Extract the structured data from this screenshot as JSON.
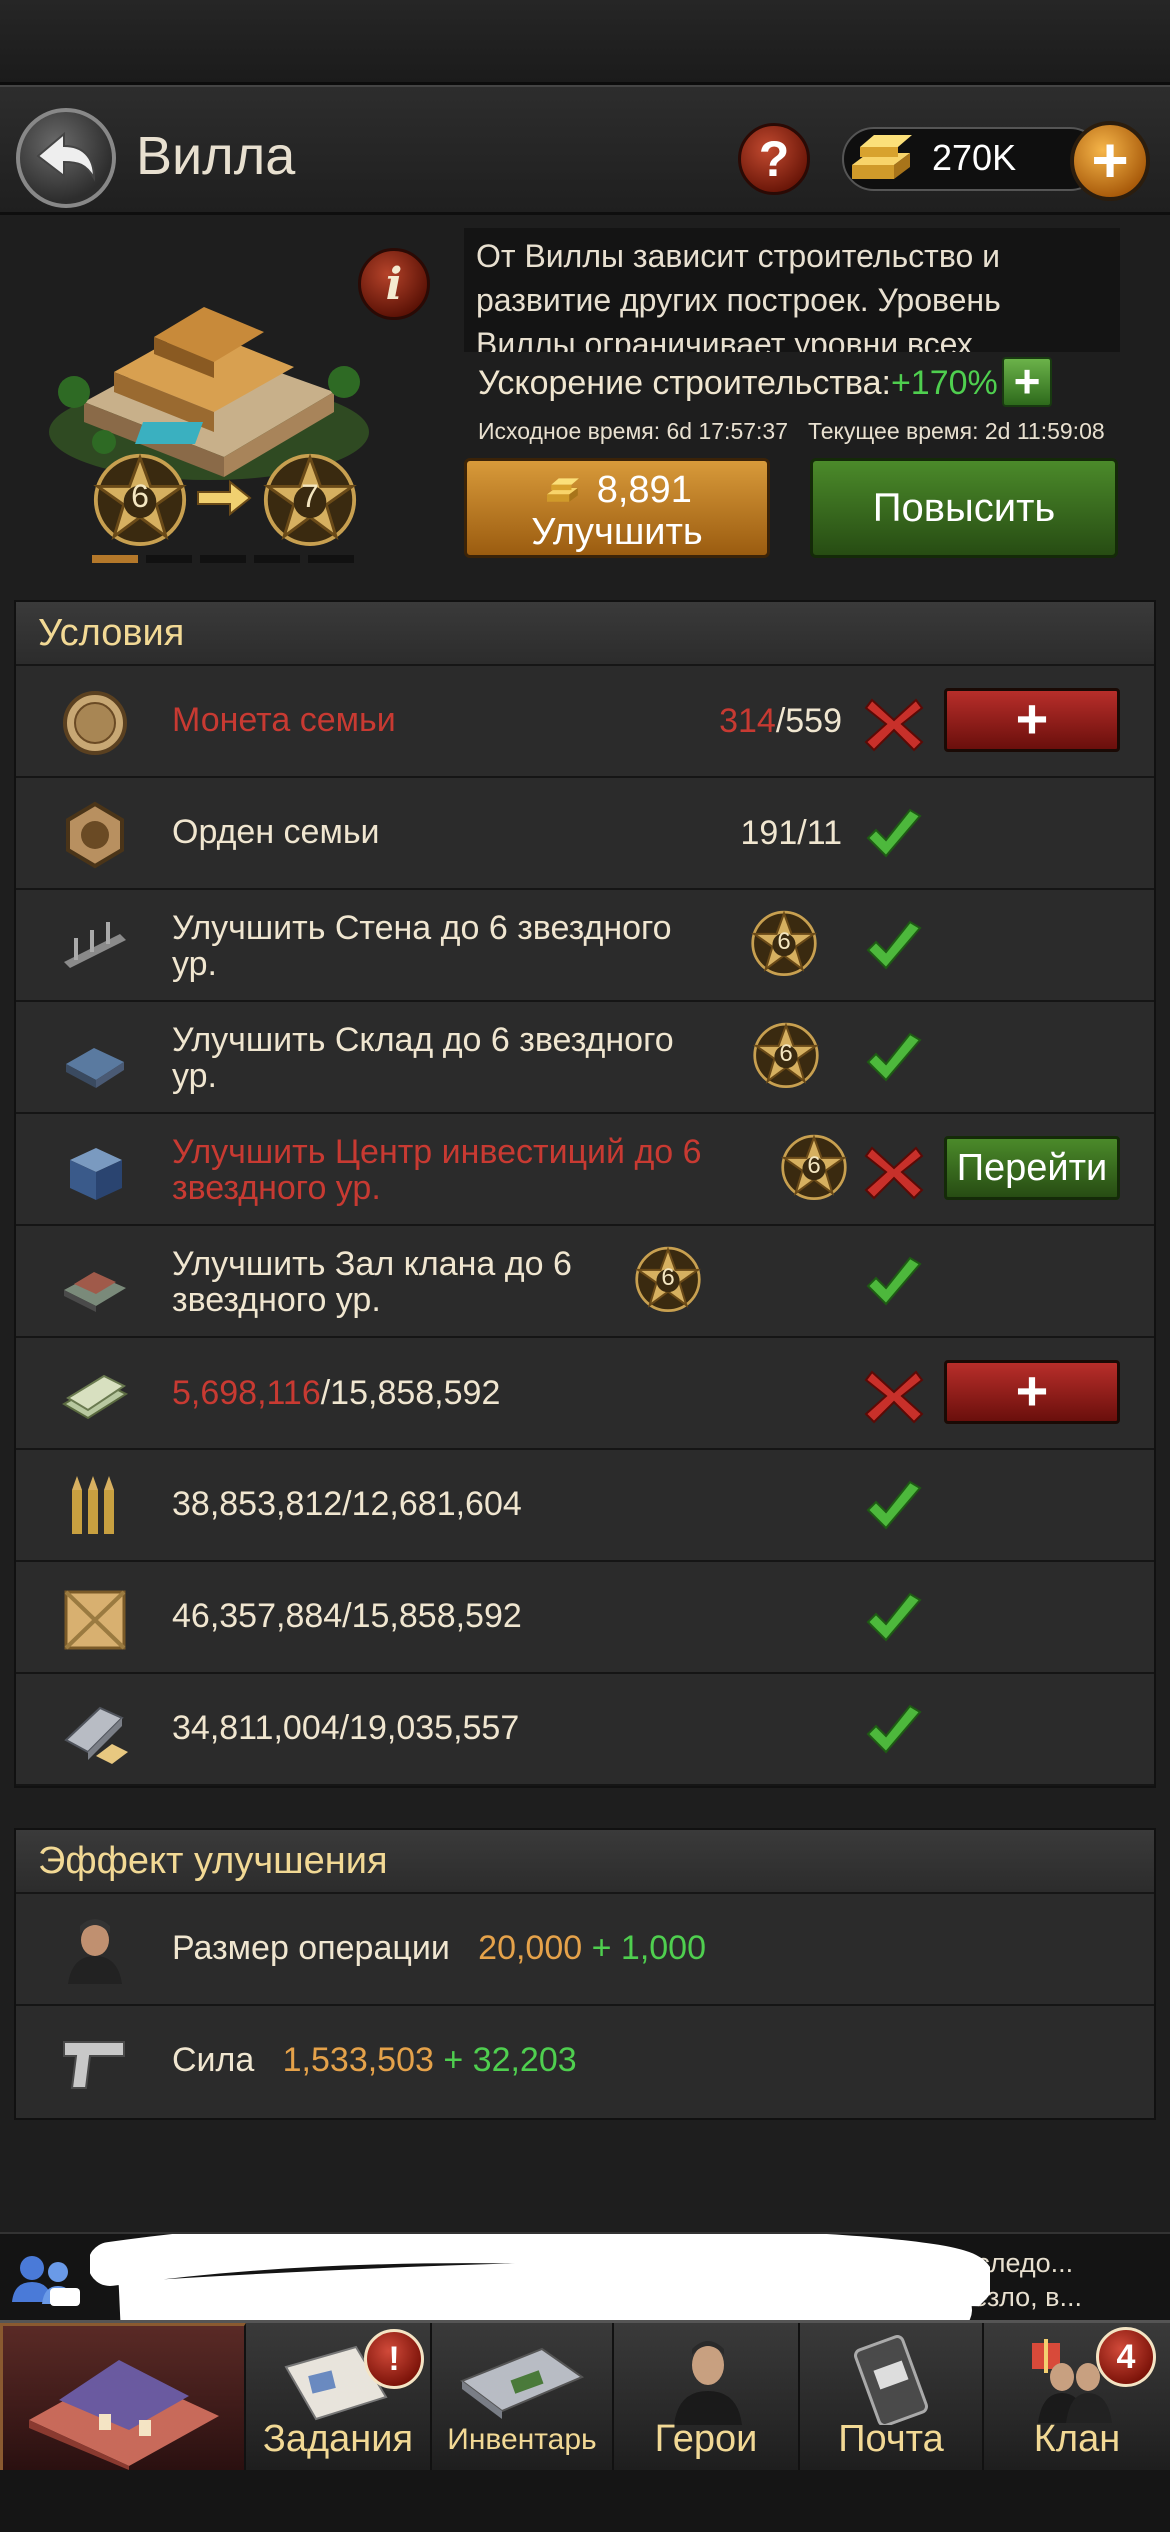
{
  "header": {
    "title": "Вилла",
    "help_icon": "?",
    "gold_amount": "270K",
    "gold_plus": "+"
  },
  "building": {
    "info_icon": "i",
    "description": "От Виллы зависит строительство и развитие других построек. Уровень Виллы ограничивает уровни всех",
    "accel_label": "Ускорение строительства:",
    "accel_value": "+170%",
    "accel_plus": "+",
    "original_time": "Исходное время: 6d 17:57:37",
    "current_time": "Текущее время: 2d 11:59:08",
    "level_from": "6",
    "level_to": "7",
    "upgrade_cost": "8,891",
    "upgrade_label": "Улучшить",
    "promote_label": "Повысить"
  },
  "conditions": {
    "title": "Условия",
    "rows": [
      {
        "icon": "family-coin-icon",
        "label": "Монета семьи",
        "have": "314",
        "need": "/559",
        "met": false,
        "action": "+"
      },
      {
        "icon": "family-order-icon",
        "label": "Орден семьи",
        "have": "191",
        "need": "/11",
        "met": true
      },
      {
        "icon": "wall-icon",
        "line1": "Улучшить Стена до 6 звездного",
        "line2": "ур.",
        "level": "6",
        "met": true
      },
      {
        "icon": "warehouse-icon",
        "line1": "Улучшить Склад до 6 звездного",
        "line2": "ур.",
        "level": "6",
        "met": true
      },
      {
        "icon": "investment-center-icon",
        "line1": "Улучшить Центр инвестиций до 6",
        "line2": "звездного ур.",
        "level": "6",
        "met": false,
        "action": "Перейти"
      },
      {
        "icon": "clan-hall-icon",
        "line1": "Улучшить Зал клана до 6",
        "line2": "звездного ур.",
        "level": "6",
        "met": true
      },
      {
        "icon": "cash-icon",
        "have": "5,698,116",
        "need": "/15,858,592",
        "met": false,
        "action": "+"
      },
      {
        "icon": "ammo-icon",
        "value": "38,853,812/12,681,604",
        "met": true
      },
      {
        "icon": "crate-icon",
        "value": "46,357,884/15,858,592",
        "met": true
      },
      {
        "icon": "metal-icon",
        "value": "34,811,004/19,035,557",
        "met": true
      }
    ]
  },
  "effect": {
    "title": "Эффект улучшения",
    "rows": [
      {
        "icon": "gangster-icon",
        "label": "Размер операции",
        "value": "20,000",
        "increase": "+ 1,000"
      },
      {
        "icon": "pistol-icon",
        "label": "Сила",
        "value": "1,533,503",
        "increase": "+ 32,203"
      }
    ]
  },
  "chat": {
    "line1": "ностью исследо...",
    "line2": "ретно повезло, в..."
  },
  "nav": {
    "tasks": "Задания",
    "tasks_badge": "!",
    "inventory": "Инвентарь",
    "heroes": "Герои",
    "mail": "Почта",
    "clan": "Клан",
    "clan_badge": "4"
  },
  "colors": {
    "gold_text": "#f2d995",
    "accent_orange": "#e5a24a",
    "positive_green": "#4fcf4f",
    "negative_red": "#c83a32"
  }
}
